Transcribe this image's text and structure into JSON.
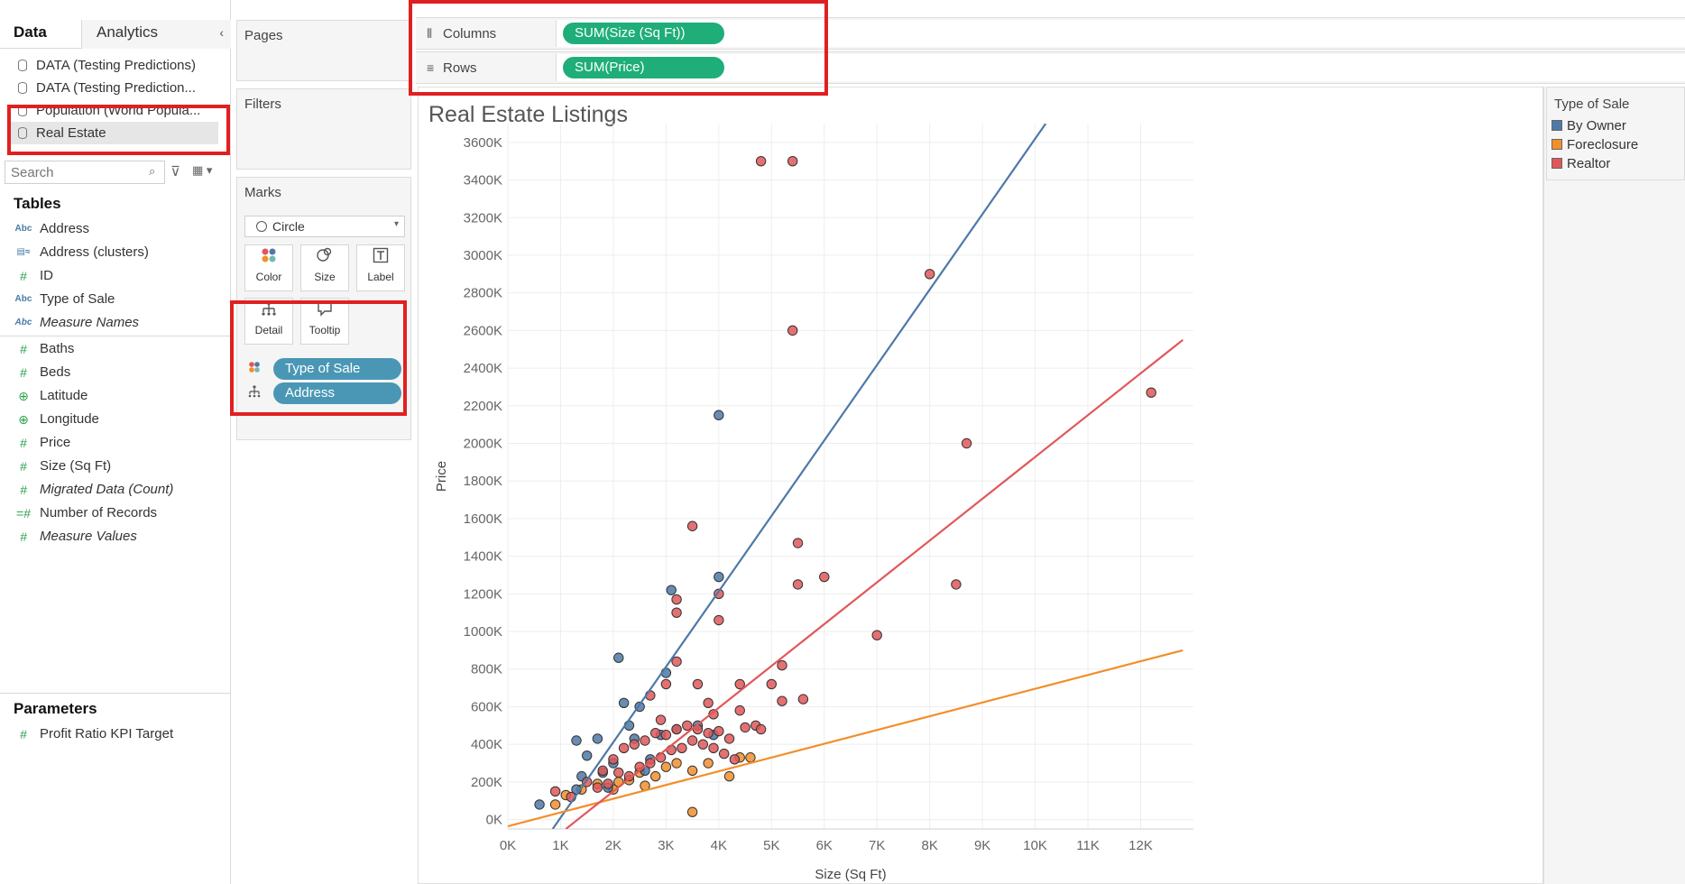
{
  "data_pane": {
    "tabs": [
      {
        "label": "Data",
        "active": true
      },
      {
        "label": "Analytics",
        "active": false
      }
    ],
    "collapse_icon": "chevron-left-icon",
    "datasources": [
      {
        "label": "DATA (Testing Predictions)"
      },
      {
        "label": "DATA (Testing Prediction..."
      },
      {
        "label": "Population (World Popula..."
      },
      {
        "label": "Real Estate",
        "selected": true
      }
    ],
    "search": {
      "placeholder": "Search"
    },
    "tables_title": "Tables",
    "dimensions": [
      {
        "label": "Address",
        "icon": "Abc",
        "italic": false
      },
      {
        "label": "Address (clusters)",
        "icon": "cluster",
        "italic": false
      },
      {
        "label": "ID",
        "icon": "#",
        "italic": false
      },
      {
        "label": "Type of Sale",
        "icon": "Abc",
        "italic": false
      },
      {
        "label": "Measure Names",
        "icon": "Abc",
        "italic": true
      }
    ],
    "measures": [
      {
        "label": "Baths",
        "icon": "#",
        "italic": false
      },
      {
        "label": "Beds",
        "icon": "#",
        "italic": false
      },
      {
        "label": "Latitude",
        "icon": "globe",
        "italic": false
      },
      {
        "label": "Longitude",
        "icon": "globe",
        "italic": false
      },
      {
        "label": "Price",
        "icon": "#",
        "italic": false
      },
      {
        "label": "Size (Sq Ft)",
        "icon": "#",
        "italic": false
      },
      {
        "label": "Migrated Data (Count)",
        "icon": "#",
        "italic": true
      },
      {
        "label": "Number of Records",
        "icon": "=#",
        "italic": false
      },
      {
        "label": "Measure Values",
        "icon": "#",
        "italic": true
      }
    ],
    "parameters_title": "Parameters",
    "parameters": [
      {
        "label": "Profit Ratio KPI Target",
        "icon": "#"
      }
    ]
  },
  "cards": {
    "pages_title": "Pages",
    "filters_title": "Filters",
    "marks_title": "Marks",
    "mark_type": "Circle",
    "mark_buttons": {
      "color": "Color",
      "size": "Size",
      "label": "Label",
      "detail": "Detail",
      "tooltip": "Tooltip"
    },
    "mark_pills": [
      {
        "label": "Type of Sale",
        "encoding": "color"
      },
      {
        "label": "Address",
        "encoding": "detail"
      }
    ]
  },
  "shelves": {
    "columns_label": "Columns",
    "columns_pill": "SUM(Size (Sq Ft))",
    "rows_label": "Rows",
    "rows_pill": "SUM(Price)"
  },
  "view": {
    "title": "Real Estate Listings"
  },
  "legend": {
    "title": "Type of Sale",
    "items": [
      {
        "label": "By Owner",
        "color": "#4e79a7"
      },
      {
        "label": "Foreclosure",
        "color": "#f28e2b"
      },
      {
        "label": "Realtor",
        "color": "#e15759"
      }
    ]
  },
  "chart_data": {
    "type": "scatter",
    "title": "Real Estate Listings",
    "xlabel": "Size (Sq Ft)",
    "ylabel": "Price",
    "xlim": [
      0,
      13000
    ],
    "ylim": [
      -50000,
      3700000
    ],
    "x_ticks": [
      "0K",
      "1K",
      "2K",
      "3K",
      "4K",
      "5K",
      "6K",
      "7K",
      "8K",
      "9K",
      "10K",
      "11K",
      "12K"
    ],
    "y_ticks": [
      "0K",
      "200K",
      "400K",
      "600K",
      "800K",
      "1000K",
      "1200K",
      "1400K",
      "1600K",
      "1800K",
      "2000K",
      "2200K",
      "2400K",
      "2600K",
      "2800K",
      "3000K",
      "3200K",
      "3400K",
      "3600K"
    ],
    "grid": true,
    "legend": "right",
    "series": [
      {
        "name": "By Owner",
        "color": "#4e79a7",
        "points": [
          [
            600,
            80000
          ],
          [
            1300,
            420000
          ],
          [
            1300,
            160000
          ],
          [
            1500,
            340000
          ],
          [
            1700,
            430000
          ],
          [
            1800,
            250000
          ],
          [
            2000,
            300000
          ],
          [
            2100,
            860000
          ],
          [
            2200,
            620000
          ],
          [
            2300,
            500000
          ],
          [
            2400,
            430000
          ],
          [
            2500,
            600000
          ],
          [
            2700,
            320000
          ],
          [
            2900,
            450000
          ],
          [
            3000,
            780000
          ],
          [
            3100,
            1220000
          ],
          [
            3200,
            480000
          ],
          [
            3600,
            500000
          ],
          [
            3900,
            450000
          ],
          [
            4000,
            1290000
          ],
          [
            4000,
            2150000
          ],
          [
            1400,
            230000
          ],
          [
            1900,
            170000
          ],
          [
            2600,
            260000
          ]
        ],
        "trend": [
          [
            850,
            -50000
          ],
          [
            10200,
            3700000
          ]
        ]
      },
      {
        "name": "Foreclosure",
        "color": "#f28e2b",
        "points": [
          [
            900,
            80000
          ],
          [
            1100,
            130000
          ],
          [
            1400,
            160000
          ],
          [
            1700,
            190000
          ],
          [
            2000,
            160000
          ],
          [
            2300,
            210000
          ],
          [
            2500,
            250000
          ],
          [
            2800,
            230000
          ],
          [
            3000,
            280000
          ],
          [
            3200,
            300000
          ],
          [
            3500,
            260000
          ],
          [
            3500,
            40000
          ],
          [
            4200,
            230000
          ],
          [
            4400,
            330000
          ],
          [
            4600,
            330000
          ],
          [
            2100,
            200000
          ],
          [
            2600,
            180000
          ],
          [
            3800,
            300000
          ]
        ],
        "trend": [
          [
            -200,
            -50000
          ],
          [
            12800,
            900000
          ]
        ]
      },
      {
        "name": "Realtor",
        "color": "#e15759",
        "points": [
          [
            4800,
            3500000
          ],
          [
            5400,
            3500000
          ],
          [
            8000,
            2900000
          ],
          [
            5400,
            2600000
          ],
          [
            12200,
            2270000
          ],
          [
            8700,
            2000000
          ],
          [
            3500,
            1560000
          ],
          [
            5500,
            1470000
          ],
          [
            5500,
            1250000
          ],
          [
            6000,
            1290000
          ],
          [
            8500,
            1250000
          ],
          [
            4000,
            1200000
          ],
          [
            4000,
            1060000
          ],
          [
            3200,
            1170000
          ],
          [
            3200,
            1100000
          ],
          [
            3200,
            840000
          ],
          [
            3000,
            720000
          ],
          [
            7000,
            980000
          ],
          [
            5200,
            820000
          ],
          [
            5000,
            720000
          ],
          [
            5200,
            630000
          ],
          [
            5600,
            640000
          ],
          [
            4400,
            720000
          ],
          [
            4400,
            580000
          ],
          [
            4500,
            490000
          ],
          [
            4700,
            500000
          ],
          [
            4800,
            480000
          ],
          [
            3600,
            720000
          ],
          [
            3800,
            620000
          ],
          [
            3900,
            560000
          ],
          [
            2700,
            660000
          ],
          [
            2900,
            530000
          ],
          [
            900,
            150000
          ],
          [
            1200,
            120000
          ],
          [
            1500,
            200000
          ],
          [
            1800,
            260000
          ],
          [
            2000,
            320000
          ],
          [
            2200,
            380000
          ],
          [
            2400,
            400000
          ],
          [
            2600,
            420000
          ],
          [
            2800,
            460000
          ],
          [
            3000,
            450000
          ],
          [
            3200,
            480000
          ],
          [
            3400,
            500000
          ],
          [
            3600,
            480000
          ],
          [
            3800,
            460000
          ],
          [
            4000,
            470000
          ],
          [
            4200,
            430000
          ],
          [
            2500,
            280000
          ],
          [
            2700,
            300000
          ],
          [
            2900,
            330000
          ],
          [
            3100,
            370000
          ],
          [
            3300,
            380000
          ],
          [
            3500,
            420000
          ],
          [
            3700,
            400000
          ],
          [
            3900,
            380000
          ],
          [
            4100,
            350000
          ],
          [
            4300,
            320000
          ],
          [
            2300,
            230000
          ],
          [
            2100,
            250000
          ],
          [
            1900,
            190000
          ],
          [
            1700,
            170000
          ]
        ],
        "trend": [
          [
            1100,
            -50000
          ],
          [
            12800,
            2550000
          ]
        ]
      }
    ]
  }
}
